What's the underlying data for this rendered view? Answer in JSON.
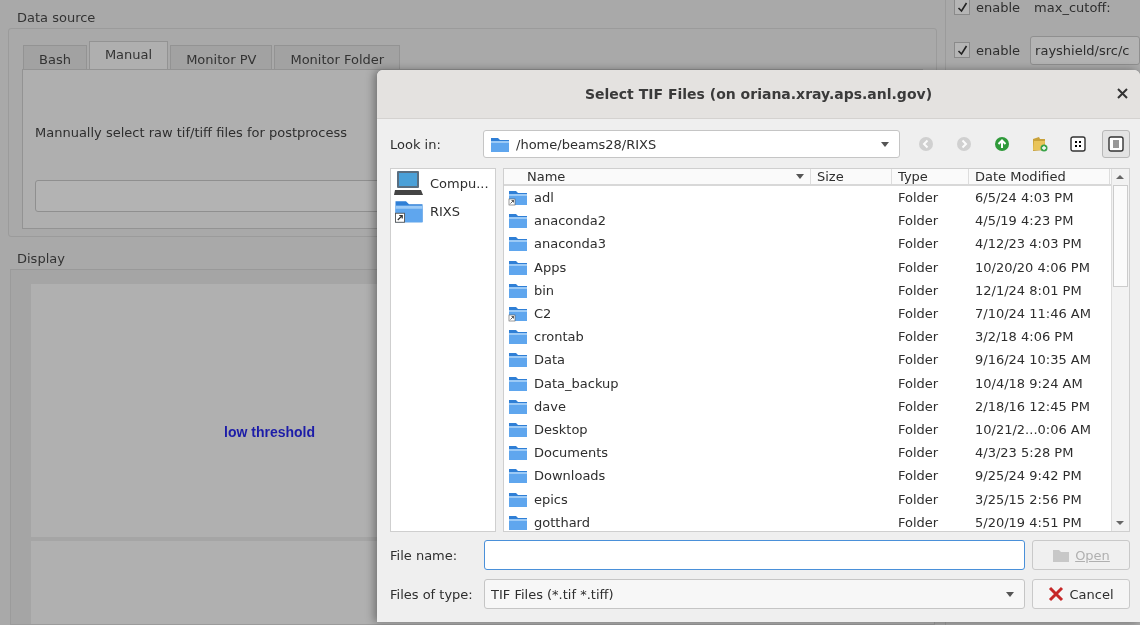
{
  "main_window": {
    "data_source": {
      "title": "Data source",
      "tabs": [
        {
          "label": "Bash",
          "selected": false
        },
        {
          "label": "Manual",
          "selected": true
        },
        {
          "label": "Monitor PV",
          "selected": false
        },
        {
          "label": "Monitor Folder",
          "selected": false
        }
      ],
      "description": "Mannually select raw tif/tiff files for postprocess"
    },
    "options": [
      {
        "checked": true,
        "label": "enable",
        "value": "max_cutoff:"
      },
      {
        "checked": true,
        "label": "enable",
        "value": "rayshield/src/c"
      }
    ],
    "display": {
      "title": "Display",
      "plot_label": "low threshold"
    }
  },
  "dialog": {
    "title": "Select TIF Files (on oriana.xray.aps.anl.gov)",
    "look_in": {
      "label": "Look in:",
      "value": "/home/beams28/RIXS"
    },
    "nav_buttons": [
      {
        "kind": "back",
        "disabled": true
      },
      {
        "kind": "forward",
        "disabled": true
      },
      {
        "kind": "up",
        "disabled": false
      },
      {
        "kind": "new-folder",
        "disabled": false
      },
      {
        "kind": "icon-view",
        "selected": false
      },
      {
        "kind": "detail-view",
        "selected": true
      }
    ],
    "places": [
      {
        "kind": "computer",
        "label": "Compu..."
      },
      {
        "kind": "link",
        "label": "RIXS"
      }
    ],
    "columns": [
      {
        "label": "Name",
        "sorted": true
      },
      {
        "label": "Size",
        "sorted": false
      },
      {
        "label": "Type",
        "sorted": false
      },
      {
        "label": "Date Modified",
        "sorted": false
      }
    ],
    "files": [
      {
        "kind": "link",
        "name": "adl",
        "type": "Folder",
        "date": "6/5/24 4:03 PM"
      },
      {
        "kind": "folder",
        "name": "anaconda2",
        "type": "Folder",
        "date": "4/5/19 4:23 PM"
      },
      {
        "kind": "folder",
        "name": "anaconda3",
        "type": "Folder",
        "date": "4/12/23 4:03 PM"
      },
      {
        "kind": "folder",
        "name": "Apps",
        "type": "Folder",
        "date": "10/20/20 4:06 PM"
      },
      {
        "kind": "folder",
        "name": "bin",
        "type": "Folder",
        "date": "12/1/24 8:01 PM"
      },
      {
        "kind": "link",
        "name": "C2",
        "type": "Folder",
        "date": "7/10/24 11:46 AM"
      },
      {
        "kind": "folder",
        "name": "crontab",
        "type": "Folder",
        "date": "3/2/18 4:06 PM"
      },
      {
        "kind": "folder",
        "name": "Data",
        "type": "Folder",
        "date": "9/16/24 10:35 AM"
      },
      {
        "kind": "folder",
        "name": "Data_backup",
        "type": "Folder",
        "date": "10/4/18 9:24 AM"
      },
      {
        "kind": "folder",
        "name": "dave",
        "type": "Folder",
        "date": "2/18/16 12:45 PM"
      },
      {
        "kind": "folder",
        "name": "Desktop",
        "type": "Folder",
        "date": "10/21/2...0:06 AM"
      },
      {
        "kind": "folder",
        "name": "Documents",
        "type": "Folder",
        "date": "4/3/23 5:28 PM"
      },
      {
        "kind": "folder",
        "name": "Downloads",
        "type": "Folder",
        "date": "9/25/24 9:42 PM"
      },
      {
        "kind": "folder",
        "name": "epics",
        "type": "Folder",
        "date": "3/25/15 2:56 PM"
      },
      {
        "kind": "folder",
        "name": "gotthard",
        "type": "Folder",
        "date": "5/20/19 4:51 PM"
      }
    ],
    "file_name": {
      "label": "File name:"
    },
    "file_type": {
      "label": "Files of type:",
      "value": "TIF Files (*.tif *.tiff)"
    },
    "open_button": {
      "label": "Open",
      "disabled": true
    },
    "cancel_button": {
      "label": "Cancel"
    }
  }
}
